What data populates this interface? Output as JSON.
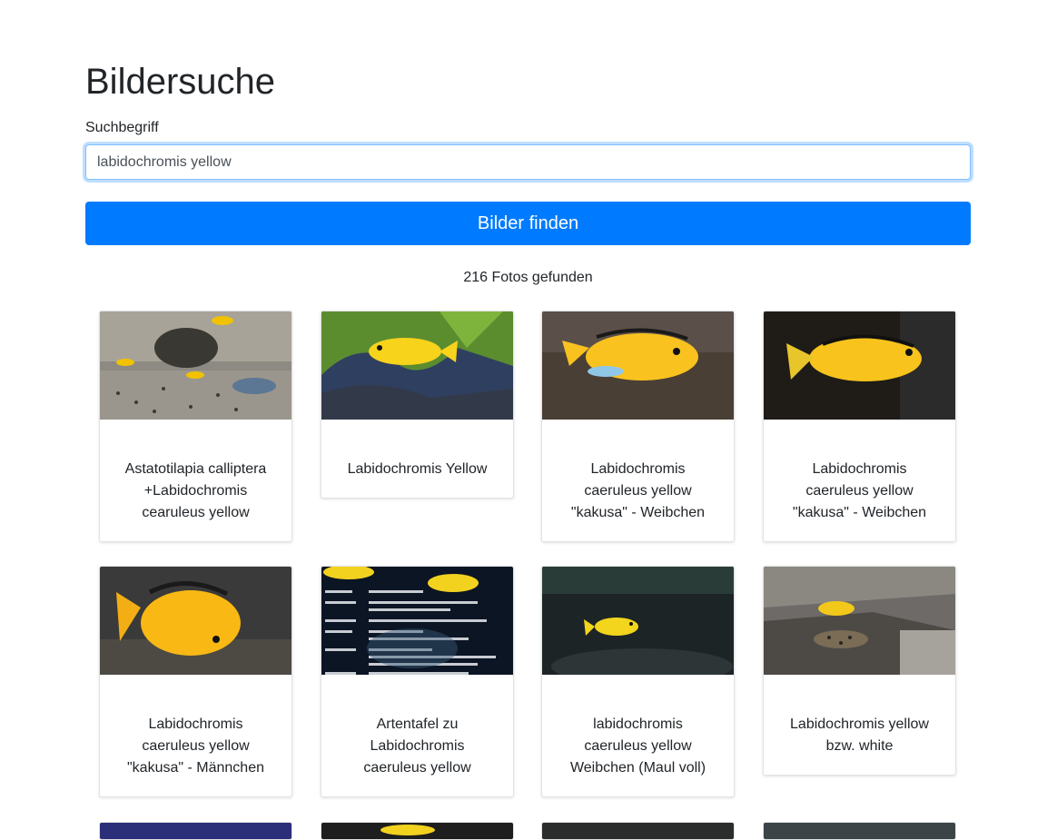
{
  "page": {
    "title": "Bildersuche",
    "search_label": "Suchbegriff",
    "search_value": "labidochromis yellow",
    "submit_label": "Bilder finden",
    "result_count": "216 Fotos gefunden"
  },
  "results": [
    {
      "title": "Astatotilapia calliptera +Labidochromis cearuleus yellow",
      "image": "Aquarium mit blauen und gelben Buntbarschen"
    },
    {
      "title": "Labidochromis Yellow",
      "image": "Gelber Buntbarsch vor Pflanzen"
    },
    {
      "title": "Labidochromis caeruleus yellow \"kakusa\" - Weibchen",
      "image": "Gelber Buntbarsch seitlich"
    },
    {
      "title": "Labidochromis caeruleus yellow \"kakusa\" - Weibchen",
      "image": "Gelber Buntbarsch vor dunklem Hintergrund"
    },
    {
      "title": "Labidochromis caeruleus yellow \"kakusa\" - Männchen",
      "image": "Gelber Buntbarsch Nahaufnahme"
    },
    {
      "title": "Artentafel zu Labidochromis caeruleus yellow",
      "image": "Artentafel mit Text"
    },
    {
      "title": "labidochromis caeruleus yellow Weibchen (Maul voll)",
      "image": "Gelber Fisch im dunklen Wasser"
    },
    {
      "title": "Labidochromis yellow bzw. white",
      "image": "Felsen mit gelbem Fisch und Welsen"
    }
  ],
  "colors": {
    "primary": "#007bff",
    "text": "#212529",
    "focus_border": "#80bdff"
  }
}
